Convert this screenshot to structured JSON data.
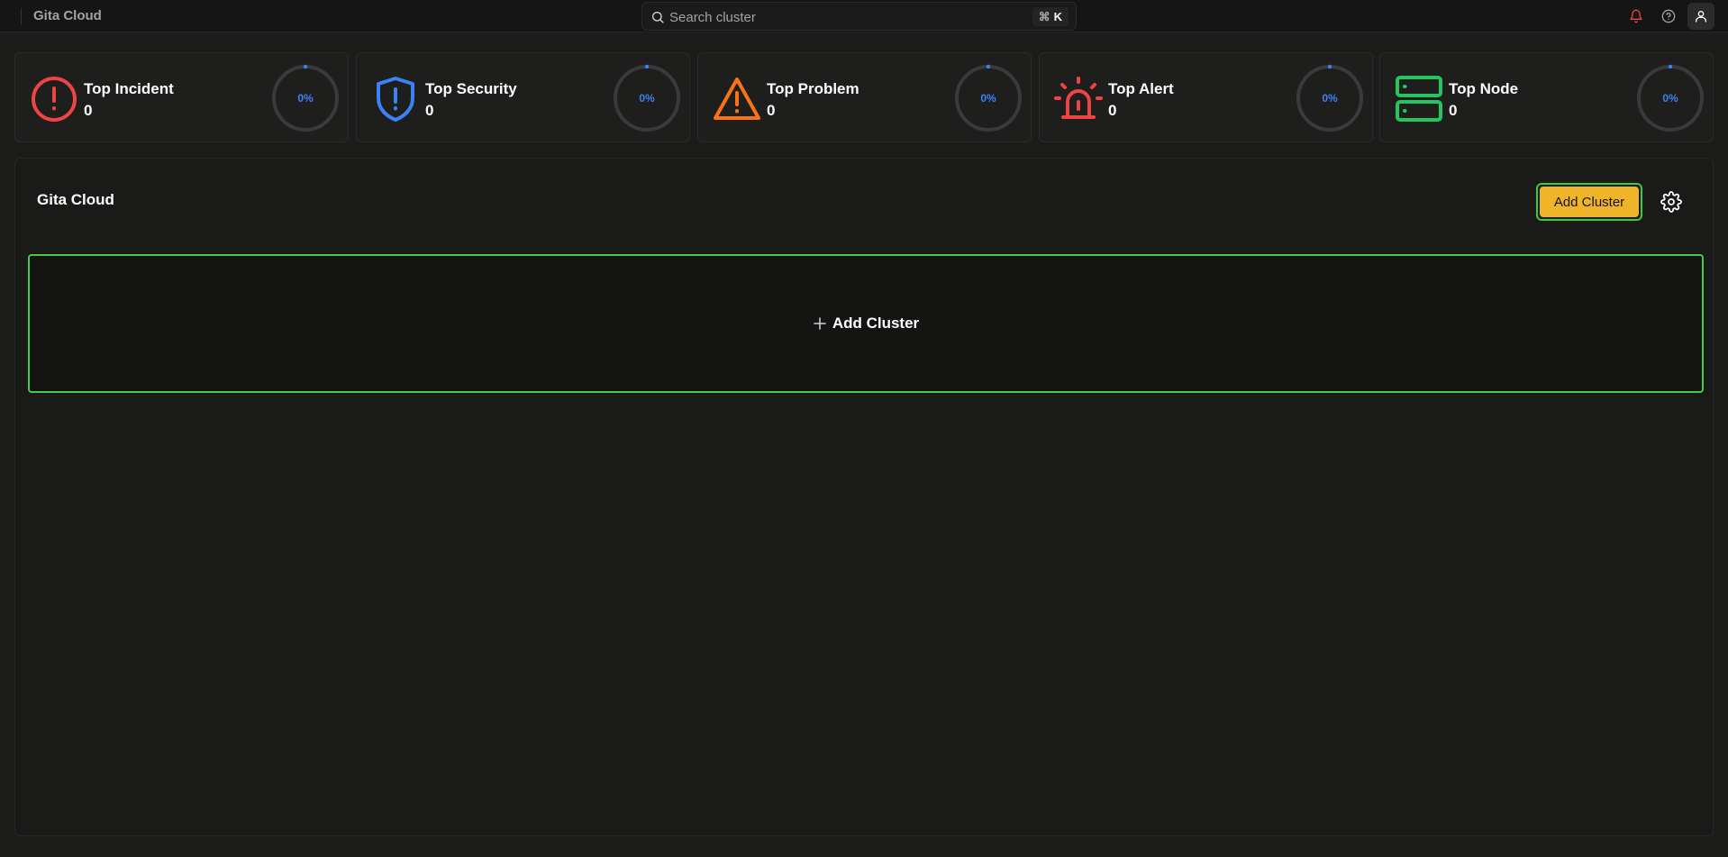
{
  "header": {
    "app_title": "Gita Cloud",
    "search": {
      "placeholder": "Search cluster",
      "shortcut_symbol": "⌘",
      "shortcut_key": "K"
    },
    "icons": {
      "bell": "bell-icon",
      "help": "help-circle-icon",
      "user": "user-icon"
    }
  },
  "stats": [
    {
      "label": "Top Incident",
      "value": "0",
      "percent_text": "0%",
      "percent": 0,
      "icon": "alert-circle-icon",
      "color": "#ef4444"
    },
    {
      "label": "Top Security",
      "value": "0",
      "percent_text": "0%",
      "percent": 0,
      "icon": "shield-alert-icon",
      "color": "#3b82f6"
    },
    {
      "label": "Top Problem",
      "value": "0",
      "percent_text": "0%",
      "percent": 0,
      "icon": "warning-triangle-icon",
      "color": "#f97316"
    },
    {
      "label": "Top Alert",
      "value": "0",
      "percent_text": "0%",
      "percent": 0,
      "icon": "siren-icon",
      "color": "#ef4444"
    },
    {
      "label": "Top Node",
      "value": "0",
      "percent_text": "0%",
      "percent": 0,
      "icon": "server-icon",
      "color": "#22c55e"
    }
  ],
  "main": {
    "title": "Gita Cloud",
    "add_cluster_label": "Add Cluster",
    "settings_icon": "gear-icon",
    "placeholder_label": "Add Cluster"
  },
  "colors": {
    "accent_yellow": "#f0b429",
    "focus_green": "#3ccb3c",
    "gauge_blue": "#3b82f6",
    "background": "#1c1c1b"
  }
}
